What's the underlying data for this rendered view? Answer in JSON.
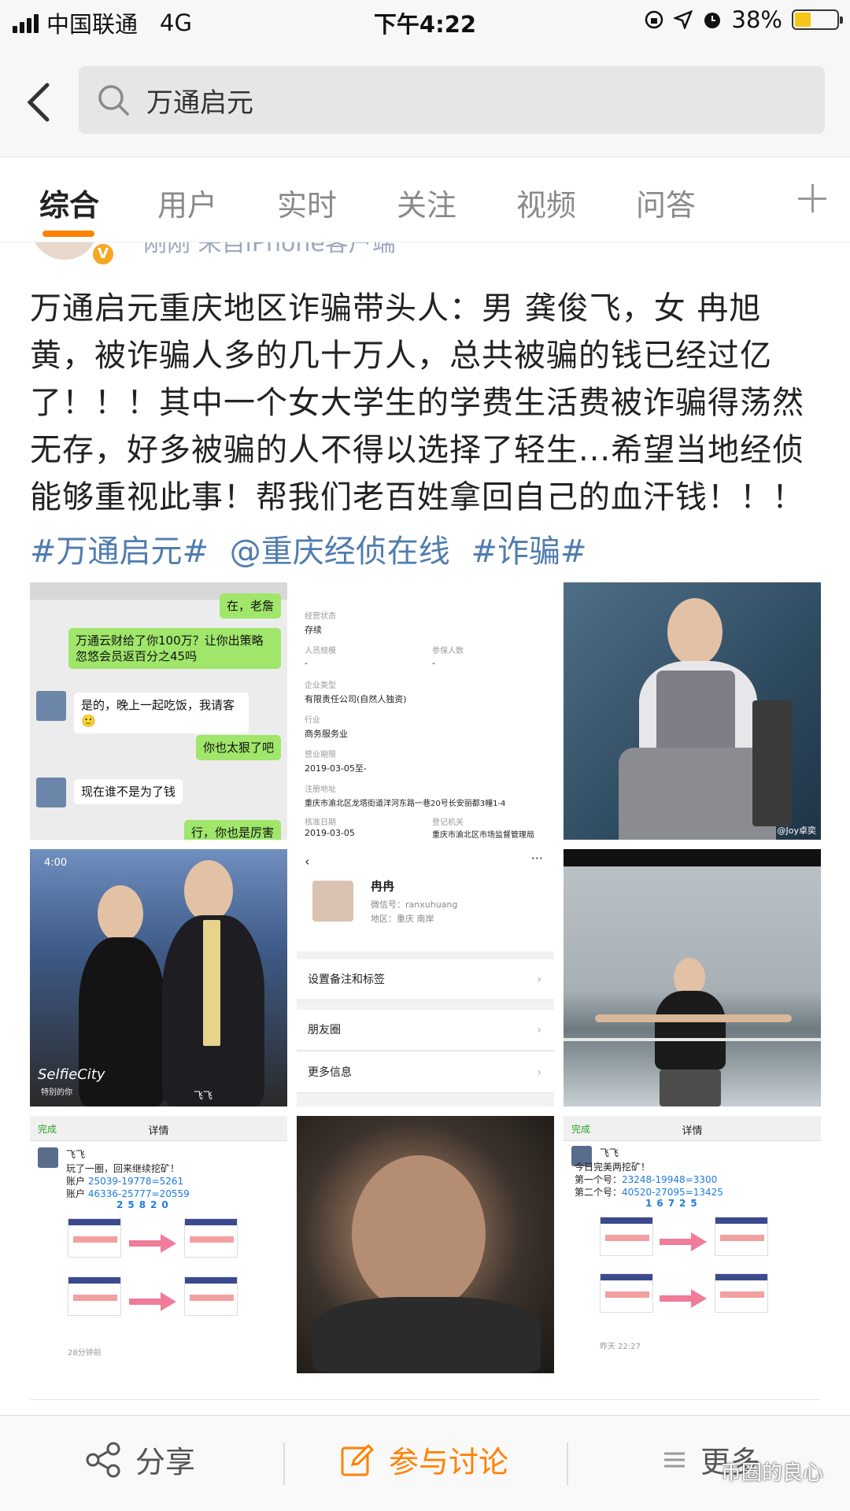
{
  "status": {
    "carrier": "中国联通",
    "network": "4G",
    "time": "下午4:22",
    "battery": "38%",
    "battery_level": 0.38
  },
  "search": {
    "query": "万通启元"
  },
  "tabs": [
    {
      "label": "综合",
      "active": true
    },
    {
      "label": "用户"
    },
    {
      "label": "实时"
    },
    {
      "label": "关注"
    },
    {
      "label": "视频"
    },
    {
      "label": "问答"
    }
  ],
  "post": {
    "meta": "刚刚  来自iPhone客户端",
    "text": "万通启元重庆地区诈骗带头人：男 龚俊飞，女 冉旭黄，被诈骗人多的几十万人，总共被骗的钱已经过亿了！！！其中一个女大学生的学费生活费被诈骗得荡然无存，好多被骗的人不得以选择了轻生...希望当地经侦能够重视此事！帮我们老百姓拿回自己的血汗钱！！！",
    "tags": [
      "#万通启元#",
      "@重庆经侦在线",
      "#诈骗#"
    ]
  },
  "chat": {
    "b1": "在，老詹",
    "b2": "万通云财给了你100万？让你出策略忽悠会员返百分之45吗",
    "b3": "是的，晚上一起吃饭，我请客🙂",
    "b4": "你也太狠了吧",
    "b5": "现在谁不是为了钱",
    "b6": "行，你也是厉害"
  },
  "company": {
    "status_label": "经营状态",
    "status_value": "存续",
    "staff_label": "人员规模",
    "staff_value": "-",
    "insured_label": "参保人数",
    "insured_value": "-",
    "type_label": "企业类型",
    "type_value": "有限责任公司(自然人独资)",
    "industry_label": "行业",
    "industry_value": "商务服务业",
    "term_label": "营业期限",
    "term_value": "2019-03-05至-",
    "addr_label": "注册地址",
    "addr_value": "重庆市渝北区龙塔街道洋河东路一巷20号长安丽都3幢1-4",
    "approve_label": "核准日期",
    "approve_value": "2019-03-05",
    "authority_label": "登记机关",
    "authority_value": "重庆市渝北区市场监督管理局"
  },
  "selfie": {
    "time": "4:00",
    "brand": "SelfieCity",
    "sub": "特别的你",
    "name": "飞飞"
  },
  "profile": {
    "name": "冉冉",
    "wechat": "微信号：ranxuhuang",
    "region": "地区：重庆 南岸",
    "rows": [
      "设置备注和标签",
      "朋友圈",
      "更多信息"
    ]
  },
  "photo_credit": "@Joy卓奕",
  "mine1": {
    "done": "完成",
    "title": "详情",
    "user": "飞飞",
    "line1": "玩了一圈，回来继续挖矿！",
    "acc1_label": "账户",
    "acc1": "25039-19778=5261",
    "acc2_label": "账户",
    "acc2": "46336-25777=20559",
    "total": "25820",
    "time": "28分钟前"
  },
  "mine2": {
    "done": "完成",
    "title": "详情",
    "user": "飞飞",
    "line1": "今日完美两挖矿！",
    "acc1_label": "第一个号：",
    "acc1": "23248-19948=3300",
    "acc2_label": "第二个号：",
    "acc2": "40520-27095=13425",
    "total": "16725",
    "time": "昨天 22:27"
  },
  "bottom": {
    "share": "分享",
    "discuss": "参与讨论",
    "more": "更多",
    "watermark": "币圈的良心"
  }
}
